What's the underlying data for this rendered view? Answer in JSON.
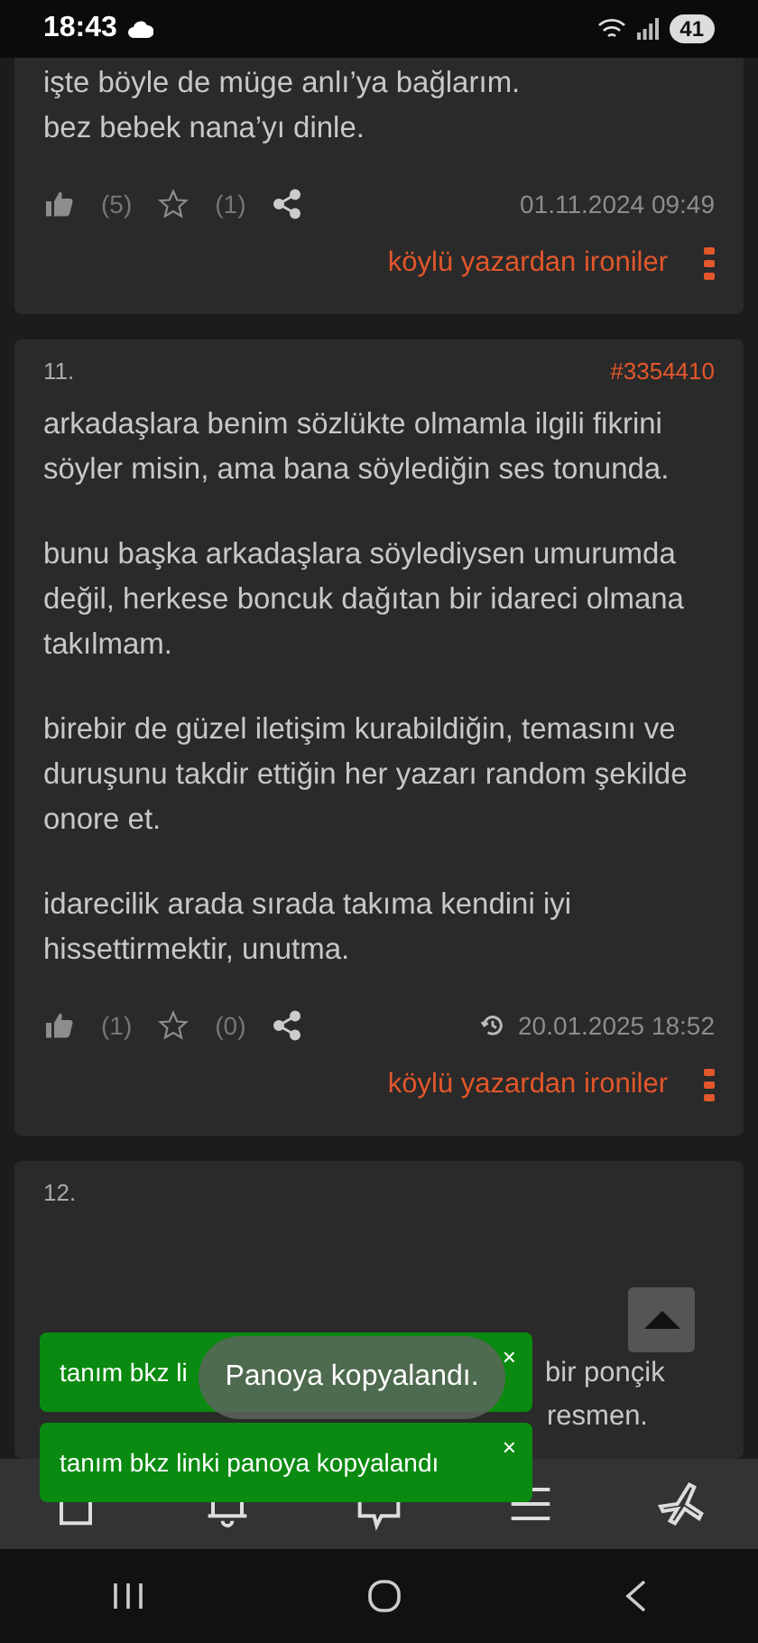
{
  "status_bar": {
    "time": "18:43",
    "battery": "41"
  },
  "entries": [
    {
      "paragraphs": [
        "işte böyle de müge anlı’ya bağlarım.\nbez bebek nana’yı dinle."
      ],
      "upvotes": "(5)",
      "favorites": "(1)",
      "edited": false,
      "date": "01.11.2024 09:49",
      "author": "köylü yazardan ironiler"
    },
    {
      "number": "11.",
      "id": "#3354410",
      "paragraphs": [
        "arkadaşlara benim sözlükte olmamla ilgili fikrini söyler misin, ama bana söylediğin ses tonunda.",
        "bunu başka arkadaşlara söylediysen umurumda değil, herkese boncuk dağıtan bir idareci olmana takılmam.",
        "birebir de güzel iletişim kurabildiğin, temasını ve duruşunu takdir ettiğin her yazarı random şekilde onore et.",
        "idarecilik arada sırada takıma kendini iyi hissettirmektir, unutma."
      ],
      "upvotes": "(1)",
      "favorites": "(0)",
      "edited": true,
      "date": "20.01.2025 18:52",
      "author": "köylü yazardan ironiler"
    }
  ],
  "partial_entry": {
    "number": "12.",
    "visible_text": [
      "bir ponçik",
      "resmen."
    ]
  },
  "toasts": [
    {
      "text": "tanım bkz linki panoya kopyalandı",
      "close": "×"
    }
  ],
  "toasts_hidden_part": {
    "text": "tanım bkz li",
    "close": "×"
  },
  "snackbar": {
    "text": "Panoya kopyalandı."
  },
  "bottom_nav": [
    {
      "kind": "home"
    },
    {
      "kind": "bell"
    },
    {
      "kind": "messages"
    },
    {
      "kind": "menu"
    },
    {
      "kind": "plane"
    }
  ]
}
